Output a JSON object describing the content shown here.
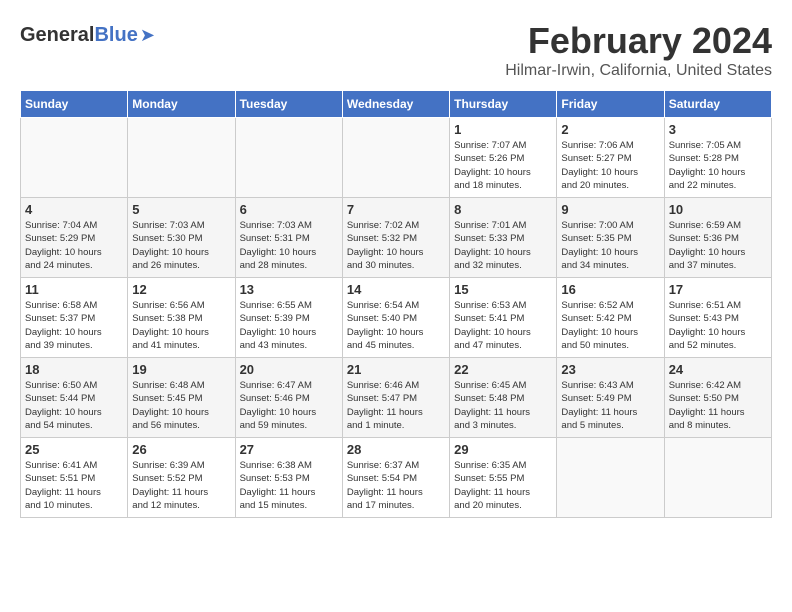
{
  "logo": {
    "general": "General",
    "blue": "Blue"
  },
  "header": {
    "title": "February 2024",
    "subtitle": "Hilmar-Irwin, California, United States"
  },
  "days_of_week": [
    "Sunday",
    "Monday",
    "Tuesday",
    "Wednesday",
    "Thursday",
    "Friday",
    "Saturday"
  ],
  "weeks": [
    [
      {
        "num": "",
        "detail": ""
      },
      {
        "num": "",
        "detail": ""
      },
      {
        "num": "",
        "detail": ""
      },
      {
        "num": "",
        "detail": ""
      },
      {
        "num": "1",
        "detail": "Sunrise: 7:07 AM\nSunset: 5:26 PM\nDaylight: 10 hours\nand 18 minutes."
      },
      {
        "num": "2",
        "detail": "Sunrise: 7:06 AM\nSunset: 5:27 PM\nDaylight: 10 hours\nand 20 minutes."
      },
      {
        "num": "3",
        "detail": "Sunrise: 7:05 AM\nSunset: 5:28 PM\nDaylight: 10 hours\nand 22 minutes."
      }
    ],
    [
      {
        "num": "4",
        "detail": "Sunrise: 7:04 AM\nSunset: 5:29 PM\nDaylight: 10 hours\nand 24 minutes."
      },
      {
        "num": "5",
        "detail": "Sunrise: 7:03 AM\nSunset: 5:30 PM\nDaylight: 10 hours\nand 26 minutes."
      },
      {
        "num": "6",
        "detail": "Sunrise: 7:03 AM\nSunset: 5:31 PM\nDaylight: 10 hours\nand 28 minutes."
      },
      {
        "num": "7",
        "detail": "Sunrise: 7:02 AM\nSunset: 5:32 PM\nDaylight: 10 hours\nand 30 minutes."
      },
      {
        "num": "8",
        "detail": "Sunrise: 7:01 AM\nSunset: 5:33 PM\nDaylight: 10 hours\nand 32 minutes."
      },
      {
        "num": "9",
        "detail": "Sunrise: 7:00 AM\nSunset: 5:35 PM\nDaylight: 10 hours\nand 34 minutes."
      },
      {
        "num": "10",
        "detail": "Sunrise: 6:59 AM\nSunset: 5:36 PM\nDaylight: 10 hours\nand 37 minutes."
      }
    ],
    [
      {
        "num": "11",
        "detail": "Sunrise: 6:58 AM\nSunset: 5:37 PM\nDaylight: 10 hours\nand 39 minutes."
      },
      {
        "num": "12",
        "detail": "Sunrise: 6:56 AM\nSunset: 5:38 PM\nDaylight: 10 hours\nand 41 minutes."
      },
      {
        "num": "13",
        "detail": "Sunrise: 6:55 AM\nSunset: 5:39 PM\nDaylight: 10 hours\nand 43 minutes."
      },
      {
        "num": "14",
        "detail": "Sunrise: 6:54 AM\nSunset: 5:40 PM\nDaylight: 10 hours\nand 45 minutes."
      },
      {
        "num": "15",
        "detail": "Sunrise: 6:53 AM\nSunset: 5:41 PM\nDaylight: 10 hours\nand 47 minutes."
      },
      {
        "num": "16",
        "detail": "Sunrise: 6:52 AM\nSunset: 5:42 PM\nDaylight: 10 hours\nand 50 minutes."
      },
      {
        "num": "17",
        "detail": "Sunrise: 6:51 AM\nSunset: 5:43 PM\nDaylight: 10 hours\nand 52 minutes."
      }
    ],
    [
      {
        "num": "18",
        "detail": "Sunrise: 6:50 AM\nSunset: 5:44 PM\nDaylight: 10 hours\nand 54 minutes."
      },
      {
        "num": "19",
        "detail": "Sunrise: 6:48 AM\nSunset: 5:45 PM\nDaylight: 10 hours\nand 56 minutes."
      },
      {
        "num": "20",
        "detail": "Sunrise: 6:47 AM\nSunset: 5:46 PM\nDaylight: 10 hours\nand 59 minutes."
      },
      {
        "num": "21",
        "detail": "Sunrise: 6:46 AM\nSunset: 5:47 PM\nDaylight: 11 hours\nand 1 minute."
      },
      {
        "num": "22",
        "detail": "Sunrise: 6:45 AM\nSunset: 5:48 PM\nDaylight: 11 hours\nand 3 minutes."
      },
      {
        "num": "23",
        "detail": "Sunrise: 6:43 AM\nSunset: 5:49 PM\nDaylight: 11 hours\nand 5 minutes."
      },
      {
        "num": "24",
        "detail": "Sunrise: 6:42 AM\nSunset: 5:50 PM\nDaylight: 11 hours\nand 8 minutes."
      }
    ],
    [
      {
        "num": "25",
        "detail": "Sunrise: 6:41 AM\nSunset: 5:51 PM\nDaylight: 11 hours\nand 10 minutes."
      },
      {
        "num": "26",
        "detail": "Sunrise: 6:39 AM\nSunset: 5:52 PM\nDaylight: 11 hours\nand 12 minutes."
      },
      {
        "num": "27",
        "detail": "Sunrise: 6:38 AM\nSunset: 5:53 PM\nDaylight: 11 hours\nand 15 minutes."
      },
      {
        "num": "28",
        "detail": "Sunrise: 6:37 AM\nSunset: 5:54 PM\nDaylight: 11 hours\nand 17 minutes."
      },
      {
        "num": "29",
        "detail": "Sunrise: 6:35 AM\nSunset: 5:55 PM\nDaylight: 11 hours\nand 20 minutes."
      },
      {
        "num": "",
        "detail": ""
      },
      {
        "num": "",
        "detail": ""
      }
    ]
  ]
}
